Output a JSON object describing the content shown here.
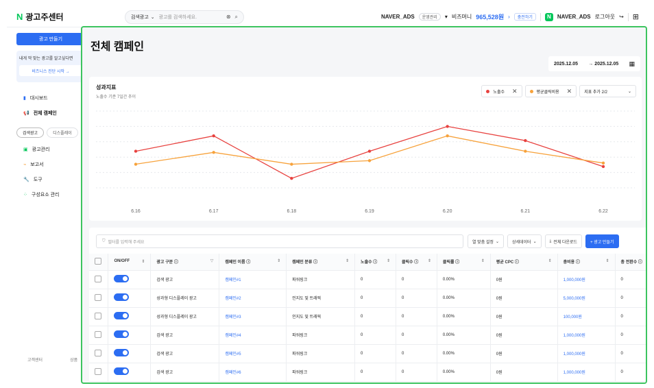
{
  "app": {
    "logo_letter": "N",
    "title": "광고주센터"
  },
  "search": {
    "scope": "검색광고",
    "placeholder": "광고를 검색하세요."
  },
  "account": {
    "name": "NAVER_ADS",
    "role": "운영관리",
    "bizmoney_label": "비즈머니",
    "bizmoney_value": "965,528원",
    "charge_label": "충전하기",
    "user": "NAVER_ADS",
    "logout": "로그아웃"
  },
  "sidebar": {
    "create_button": "광고 만들기",
    "promo_text": "내게 딱 맞는 광고를 알고싶다면",
    "promo_link": "비즈니스 진단 시작 →",
    "items": [
      {
        "label": "대시보드",
        "icon": "dashboard-icon"
      },
      {
        "label": "전체 캠페인",
        "icon": "megaphone-icon"
      }
    ],
    "tabs": [
      "검색광고",
      "디스플레이"
    ],
    "items2": [
      {
        "label": "광고관리",
        "icon": "folder-icon"
      },
      {
        "label": "보고서",
        "icon": "report-icon"
      },
      {
        "label": "도구",
        "icon": "tool-icon"
      },
      {
        "label": "구성요소 관리",
        "icon": "components-icon"
      }
    ],
    "footer": [
      "고객센터",
      "상품"
    ]
  },
  "main": {
    "title": "전체 캠페인",
    "date_from": "2025.12.05",
    "date_to": "→ 2025.12.05"
  },
  "chart_card": {
    "title": "성과지표",
    "subtitle": "노출수 기준 7일간 추이",
    "chip1": "노출수",
    "chip2": "평균클릭비용",
    "chip3": "지표 추가 2/2"
  },
  "colors": {
    "red": "#e8423f",
    "orange": "#f7a23b",
    "blue": "#2c6df2",
    "green": "#3cc45f"
  },
  "chart_data": {
    "type": "line",
    "categories": [
      "6.16",
      "6.17",
      "6.18",
      "6.19",
      "6.20",
      "6.21",
      "6.22"
    ],
    "series": [
      {
        "name": "노출수",
        "color": "#e8423f",
        "values": [
          62,
          88,
          16,
          62,
          104,
          80,
          36
        ]
      },
      {
        "name": "평균클릭비용",
        "color": "#f7a23b",
        "values": [
          40,
          60,
          40,
          46,
          88,
          62,
          42
        ]
      }
    ],
    "ylim": [
      0,
      130
    ],
    "grid": true
  },
  "table_tools": {
    "filter_placeholder": "필터를 입력해 주세요",
    "col_setting": "열 맞춤 설정",
    "detail": "상세데이터",
    "download": "전체 다운로드",
    "create": "+ 광고 만들기"
  },
  "table": {
    "headers": [
      "ON/OFF",
      "광고 구분 ⓘ",
      "캠페인 이름 ⓘ",
      "캠페인 분류 ⓘ",
      "노출수 ⓘ",
      "클릭수 ⓘ",
      "클릭률 ⓘ",
      "평균 CPC ⓘ",
      "총비용 ⓘ",
      "총 전환수 ⓘ"
    ],
    "rows": [
      [
        "검색 광고",
        "캠페인#1",
        "파워링크",
        "0",
        "0",
        "0.00%",
        "0원",
        "1,000,000원",
        "0"
      ],
      [
        "성과형 디스플레이 광고",
        "캠페인#2",
        "인지도 및 트래픽",
        "0",
        "0",
        "0.00%",
        "0원",
        "5,000,000원",
        "0"
      ],
      [
        "성과형 디스플레이 광고",
        "캠페인#3",
        "인지도 및 트래픽",
        "0",
        "0",
        "0.00%",
        "0원",
        "100,000원",
        "0"
      ],
      [
        "검색 광고",
        "캠페인#4",
        "파워링크",
        "0",
        "0",
        "0.00%",
        "0원",
        "1,000,000원",
        "0"
      ],
      [
        "검색 광고",
        "캠페인#5",
        "파워링크",
        "0",
        "0",
        "0.00%",
        "0원",
        "1,000,000원",
        "0"
      ],
      [
        "검색 광고",
        "캠페인#6",
        "파워링크",
        "0",
        "0",
        "0.00%",
        "0원",
        "1,000,000원",
        "0"
      ]
    ]
  }
}
